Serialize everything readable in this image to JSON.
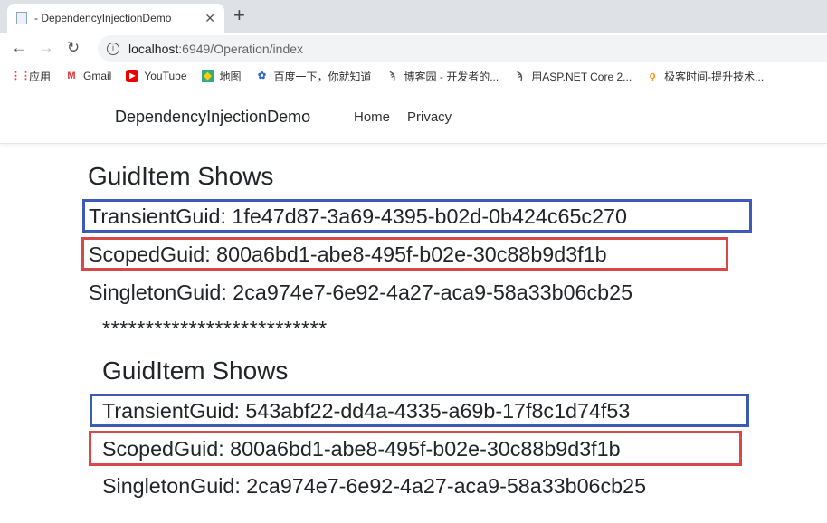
{
  "browser": {
    "tab_title": "- DependencyInjectionDemo",
    "url_host": "localhost",
    "url_rest": ":6949/Operation/index",
    "bookmarks": [
      {
        "label": "应用",
        "icon": "apps-grid-icon"
      },
      {
        "label": "Gmail",
        "icon": "gmail-icon"
      },
      {
        "label": "YouTube",
        "icon": "youtube-icon"
      },
      {
        "label": "地图",
        "icon": "maps-icon"
      },
      {
        "label": "百度一下，你就知道",
        "icon": "baidu-icon"
      },
      {
        "label": "博客园 - 开发者的...",
        "icon": "cnblogs-icon"
      },
      {
        "label": "用ASP.NET Core 2...",
        "icon": "cnblogs-icon"
      },
      {
        "label": "极客时间-提升技术...",
        "icon": "geektime-icon"
      }
    ]
  },
  "navbar": {
    "brand": "DependencyInjectionDemo",
    "links": [
      "Home",
      "Privacy"
    ]
  },
  "section1": {
    "heading": "GuidItem Shows",
    "transient": "TransientGuid: 1fe47d87-3a69-4395-b02d-0b424c65c270",
    "scoped": "ScopedGuid: 800a6bd1-abe8-495f-b02e-30c88b9d3f1b",
    "singleton": "SingletonGuid: 2ca974e7-6e92-4a27-aca9-58a33b06cb25"
  },
  "separator": "**************************",
  "section2": {
    "heading": "GuidItem Shows",
    "transient": "TransientGuid: 543abf22-dd4a-4335-a69b-17f8c1d74f53",
    "scoped": "ScopedGuid: 800a6bd1-abe8-495f-b02e-30c88b9d3f1b",
    "singleton": "SingletonGuid: 2ca974e7-6e92-4a27-aca9-58a33b06cb25"
  },
  "colors": {
    "transient_box": "#3b5bb5",
    "scoped_box": "#d94848"
  }
}
